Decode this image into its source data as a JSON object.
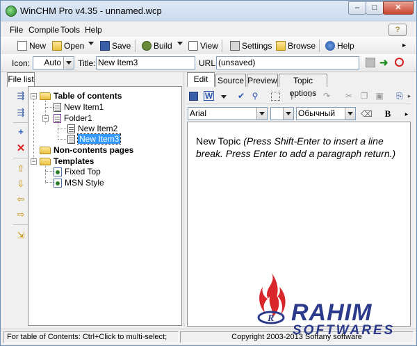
{
  "window": {
    "title": "WinCHM Pro v4.35 - unnamed.wcp",
    "controls": {
      "minimize": "–",
      "maximize": "□",
      "close": "✕"
    }
  },
  "menu": {
    "items": [
      "File",
      "Compile",
      "Tools",
      "Help"
    ]
  },
  "toolbar": {
    "new": "New",
    "open": "Open",
    "save": "Save",
    "build": "Build",
    "view": "View",
    "settings": "Settings",
    "browse": "Browse",
    "help": "Help",
    "overflow": "▸"
  },
  "props": {
    "icon_label": "Icon:",
    "icon_value": "Auto",
    "title_label": "Title:",
    "title_value": "New Item3",
    "url_label": "URL:",
    "url_value": "(unsaved)"
  },
  "left_panel": {
    "tab": "File list",
    "tree": {
      "toc": "Table of contents",
      "new_item1": "New Item1",
      "folder1": "Folder1",
      "new_item2": "New Item2",
      "new_item3": "New Item3",
      "non_contents": "Non-contents pages",
      "templates": "Templates",
      "fixed_top": "Fixed Top",
      "msn_style": "MSN Style"
    }
  },
  "editor": {
    "tabs": [
      "Edit",
      "Source",
      "Preview",
      "Topic options"
    ],
    "font_value": "Arial",
    "style_value": "Обычный",
    "bold_label": "B",
    "body_plain": "New Topic ",
    "body_italic": "(Press Shift-Enter to insert a line break. Press Enter to add a paragraph return.)"
  },
  "status": {
    "hint": "For table of Contents: Ctrl+Click to multi-select;",
    "copyright": "Copyright 2003-2013 Softany software"
  },
  "watermark": {
    "brand": "RAHIM",
    "sub": "SOFTWARES",
    "badge": "R"
  },
  "colors": {
    "accent": "#3399ff",
    "watermark": "#2b3a8a",
    "flame": "#d8262a"
  }
}
